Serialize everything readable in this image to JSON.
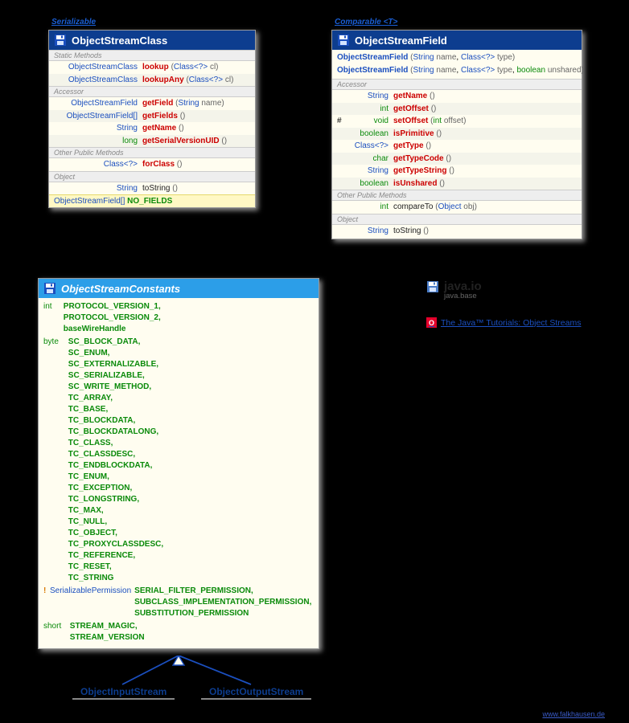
{
  "stereotypes": {
    "serializable": "Serializable",
    "comparable": "Comparable <T>"
  },
  "osc": {
    "title": "ObjectStreamClass",
    "sections": {
      "static": "Static Methods",
      "accessor": "Accessor",
      "otherPublic": "Other Public Methods",
      "object": "Object"
    },
    "static1": {
      "rtype": "ObjectStreamClass",
      "name": "lookup",
      "pType": "Class<?>",
      "pName": "cl"
    },
    "static2": {
      "rtype": "ObjectStreamClass",
      "name": "lookupAny",
      "pType": "Class<?>",
      "pName": "cl"
    },
    "acc1": {
      "rtype": "ObjectStreamField",
      "name": "getField",
      "pType": "String",
      "pName": "name"
    },
    "acc2": {
      "rtype": "ObjectStreamField[]",
      "name": "getFields"
    },
    "acc3": {
      "rtype": "String",
      "name": "getName"
    },
    "acc4": {
      "rtype": "long",
      "name": "getSerialVersionUID"
    },
    "pub1": {
      "rtype": "Class<?>",
      "name": "forClass"
    },
    "obj1": {
      "rtype": "String",
      "name": "toString"
    },
    "field": {
      "ftype": "ObjectStreamField[]",
      "fname": "NO_FIELDS"
    }
  },
  "osf": {
    "title": "ObjectStreamField",
    "ctor1": {
      "name": "ObjectStreamField",
      "p1t": "String",
      "p1n": "name",
      "p2t": "Class<?>",
      "p2n": "type"
    },
    "ctor2": {
      "name": "ObjectStreamField",
      "p1t": "String",
      "p1n": "name",
      "p2t": "Class<?>",
      "p2n": "type",
      "p3t": "boolean",
      "p3n": "unshared"
    },
    "sections": {
      "accessor": "Accessor",
      "otherPublic": "Other Public Methods",
      "object": "Object"
    },
    "acc1": {
      "rtype": "String",
      "name": "getName"
    },
    "acc2": {
      "rtype": "int",
      "name": "getOffset"
    },
    "acc3": {
      "vis": "#",
      "rtype": "void",
      "name": "setOffset",
      "pType": "int",
      "pName": "offset"
    },
    "acc4": {
      "rtype": "boolean",
      "name": "isPrimitive"
    },
    "acc5": {
      "rtype": "Class<?>",
      "name": "getType"
    },
    "acc6": {
      "rtype": "char",
      "name": "getTypeCode"
    },
    "acc7": {
      "rtype": "String",
      "name": "getTypeString"
    },
    "acc8": {
      "rtype": "boolean",
      "name": "isUnshared"
    },
    "pub1": {
      "rtype": "int",
      "name": "compareTo",
      "pType": "Object",
      "pName": "obj"
    },
    "obj1": {
      "rtype": "String",
      "name": "toString"
    }
  },
  "oscn": {
    "title": "ObjectStreamConstants",
    "intType": "int",
    "intValues": "PROTOCOL_VERSION_1,\nPROTOCOL_VERSION_2,\nbaseWireHandle",
    "byteType": "byte",
    "byteValues": "SC_BLOCK_DATA,\nSC_ENUM,\nSC_EXTERNALIZABLE,\nSC_SERIALIZABLE,\nSC_WRITE_METHOD,\nTC_ARRAY,\nTC_BASE,\nTC_BLOCKDATA,\nTC_BLOCKDATALONG,\nTC_CLASS,\nTC_CLASSDESC,\nTC_ENDBLOCKDATA,\nTC_ENUM,\nTC_EXCEPTION,\nTC_LONGSTRING,\nTC_MAX,\nTC_NULL,\nTC_OBJECT,\nTC_PROXYCLASSDESC,\nTC_REFERENCE,\nTC_RESET,\nTC_STRING",
    "permMarker": "!",
    "permType": "SerializablePermission",
    "permValues": "SERIAL_FILTER_PERMISSION,\nSUBCLASS_IMPLEMENTATION_PERMISSION,\nSUBSTITUTION_PERMISSION",
    "shortType": "short",
    "shortValues": "STREAM_MAGIC,\nSTREAM_VERSION"
  },
  "pkg": {
    "name": "java.io",
    "module": "java.base"
  },
  "tutorial": "The Java™ Tutorials: Object Streams",
  "children": {
    "ois": "ObjectInputStream",
    "oos": "ObjectOutputStream"
  },
  "footer": "www.falkhausen.de"
}
